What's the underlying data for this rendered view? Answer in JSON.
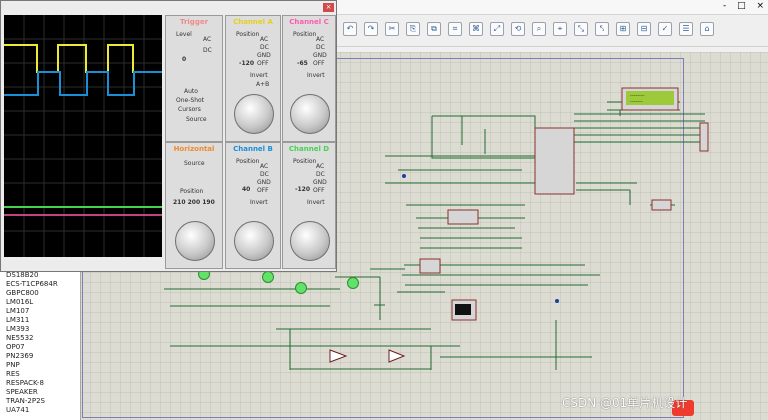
{
  "window_controls": [
    "-",
    "□",
    "×"
  ],
  "toolbar_icons": [
    "↶",
    "↷",
    "✂",
    "⎘",
    "⧉",
    "⌗",
    "⌘",
    "⤢",
    "⟲",
    "⌕",
    "⌖",
    "⤡",
    "⤣",
    "⊞",
    "⊟",
    "✓",
    "☰",
    "⌂"
  ],
  "scope": {
    "trigger": "Trigger",
    "channel_a": "Channel A",
    "channel_c": "Channel C",
    "horizontal": "Horizontal",
    "channel_b": "Channel B",
    "channel_d": "Channel D",
    "level": "Level",
    "position": "Position",
    "ac": "AC",
    "dc": "DC",
    "gnd": "GND",
    "off": "OFF",
    "invert": "Invert",
    "a_plus_b": "A+B",
    "auto": "Auto",
    "one_shot": "One-Shot",
    "cursors": "Cursors",
    "source": "Source",
    "values": {
      "trigger_level": "0",
      "a_pos": "-120",
      "c_pos": "-65",
      "b_pos": "40",
      "d_pos": "-120",
      "horiz_pos": "210 200 190"
    }
  },
  "lcd_text": [
    "--------",
    "-------"
  ],
  "devices": [
    "DS18B20",
    "ECS-T1CP684R",
    "GBPC800",
    "LM016L",
    "LM107",
    "LM311",
    "LM393",
    "NE5532",
    "OP07",
    "PN2369",
    "PNP",
    "RES",
    "RESPACK-8",
    "SPEAKER",
    "TRAN-2P2S",
    "UA741"
  ],
  "watermark": "CSDN @01单片机设计",
  "colors": {
    "trace_yellow": "#ecea33",
    "trace_blue": "#1b8fd6",
    "trace_green": "#47d154",
    "trace_pink": "#ff5ab0"
  }
}
